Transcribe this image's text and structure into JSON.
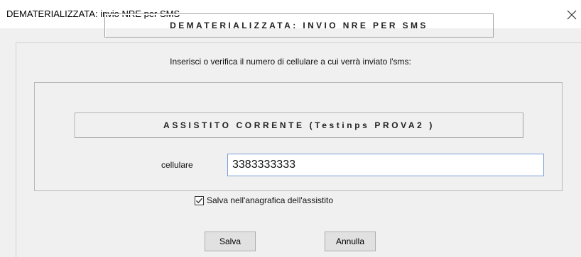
{
  "window": {
    "title": "DEMATERIALIZZATA: invio NRE per SMS",
    "close_glyph": "✕"
  },
  "dialog": {
    "header": "DEMATERIALIZZATA: INVIO NRE PER SMS",
    "instruction": "Inserisci o verifica il numero di cellulare a cui verrà inviato l'sms:",
    "patient_header": "ASSISTITO CORRENTE (Testinps PROVA2 )",
    "phone_label": "cellulare",
    "phone_value": "3383333333",
    "save_to_registry_checked": true,
    "save_to_registry_label": "Salva nell'anagrafica dell'assistito"
  },
  "buttons": {
    "save_label": "Salva",
    "cancel_label": "Annulla"
  },
  "icons": {
    "close": "close-icon",
    "check": "checkmark-icon"
  }
}
